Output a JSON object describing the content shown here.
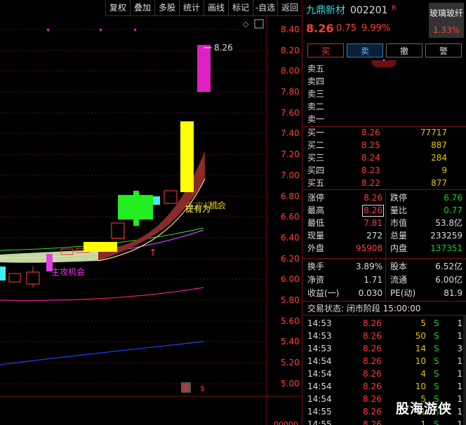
{
  "toolbar": [
    "复权",
    "叠加",
    "多股",
    "统计",
    "画线",
    "标记",
    "-自选",
    "返回"
  ],
  "chart": {
    "price_axis": [
      "8.40",
      "8.20",
      "8.00",
      "7.80",
      "7.60",
      "7.40",
      "7.20",
      "7.00",
      "6.80",
      "6.60",
      "6.40",
      "6.20",
      "6.00",
      "5.80",
      "5.60",
      "5.40",
      "5.20",
      "5.00"
    ],
    "high_label": "8.26",
    "annotations": {
      "a1": "主攻机会",
      "a2": "机会",
      "a3": "主攻机会",
      "a4": "提有为"
    },
    "bottom_markers": [
      "涨",
      "$"
    ],
    "vol_label": "00000"
  },
  "quote": {
    "name": "九鼎新材",
    "code": "002201",
    "flag": "R",
    "sector": "玻璃玻纤",
    "sector_change": "1.33%",
    "price": "8.26",
    "change": "0.75",
    "change_pct": "9.99%",
    "buttons": [
      "买",
      "卖",
      "撤",
      "警"
    ]
  },
  "sell_levels": [
    "卖五",
    "卖四",
    "卖三",
    "卖二",
    "卖一"
  ],
  "buy_levels": [
    {
      "label": "买一",
      "price": "8.26",
      "vol": "77717"
    },
    {
      "label": "买二",
      "price": "8.25",
      "vol": "887"
    },
    {
      "label": "买三",
      "price": "8.24",
      "vol": "284"
    },
    {
      "label": "买四",
      "price": "8.23",
      "vol": "9"
    },
    {
      "label": "买五",
      "price": "8.22",
      "vol": "877"
    }
  ],
  "stats1": [
    {
      "l": "涨停",
      "v": "8.26",
      "l2": "跌停",
      "v2": "6.76"
    },
    {
      "l": "最高",
      "v": "8.26",
      "l2": "量比",
      "v2": "0.77"
    },
    {
      "l": "最低",
      "v": "7.81",
      "l2": "市值",
      "v2": "53.8亿"
    },
    {
      "l": "现量",
      "v": "272",
      "l2": "总量",
      "v2": "233259"
    },
    {
      "l": "外盘",
      "v": "95908",
      "l2": "内盘",
      "v2": "137351"
    }
  ],
  "stats2": [
    {
      "l": "换手",
      "v": "3.89%",
      "l2": "股本",
      "v2": "6.52亿"
    },
    {
      "l": "净资",
      "v": "1.71",
      "l2": "流通",
      "v2": "6.00亿"
    },
    {
      "l": "收益(一)",
      "v": "0.030",
      "l2": "PE(动)",
      "v2": "81.9"
    }
  ],
  "trade_status": "交易状态: 闭市阶段 15:00:00",
  "ticks": [
    {
      "t": "14:53",
      "p": "8.26",
      "v": "5",
      "s": "S",
      "n": "1"
    },
    {
      "t": "14:53",
      "p": "8.26",
      "v": "50",
      "s": "S",
      "n": "1"
    },
    {
      "t": "14:53",
      "p": "8.26",
      "v": "14",
      "s": "S",
      "n": "3"
    },
    {
      "t": "14:54",
      "p": "8.26",
      "v": "10",
      "s": "S",
      "n": "1"
    },
    {
      "t": "14:54",
      "p": "8.26",
      "v": "4",
      "s": "S",
      "n": "1"
    },
    {
      "t": "14:54",
      "p": "8.26",
      "v": "10",
      "s": "S",
      "n": "1"
    },
    {
      "t": "14:54",
      "p": "8.26",
      "v": "5",
      "s": "S",
      "n": "1"
    },
    {
      "t": "14:55",
      "p": "8.26",
      "v": "1",
      "s": "S",
      "n": "1"
    },
    {
      "t": "14:55",
      "p": "8.26",
      "v": "1",
      "s": "S",
      "n": "1"
    }
  ],
  "watermark": "股海游侠"
}
